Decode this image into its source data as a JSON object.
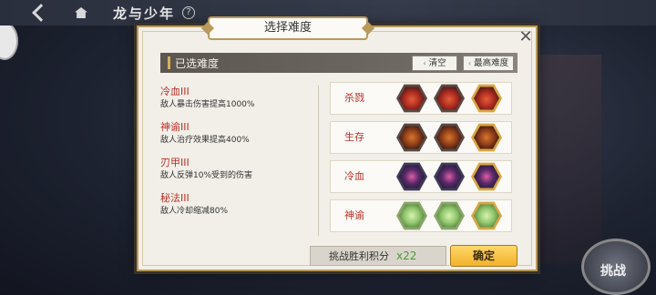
{
  "topbar": {
    "title": "龙与少年",
    "help": "?"
  },
  "dialog": {
    "title": "选择难度",
    "close": "✕",
    "selected_label": "已选难度",
    "clear_label": "清空",
    "max_label": "最高难度"
  },
  "selected": [
    {
      "name": "冷血III",
      "desc": "敌人暴击伤害提高1000%"
    },
    {
      "name": "神谕III",
      "desc": "敌人治疗效果提高400%"
    },
    {
      "name": "刃甲III",
      "desc": "敌人反弹10%受到的伤害"
    },
    {
      "name": "秘法III",
      "desc": "敌人冷却缩减80%"
    }
  ],
  "categories": [
    {
      "name": "杀戮",
      "levels_selected": 0
    },
    {
      "name": "生存",
      "levels_selected": 0
    },
    {
      "name": "冷血",
      "levels_selected": 3
    },
    {
      "name": "神谕",
      "levels_selected": 3
    }
  ],
  "footer": {
    "score_label": "挑战胜利积分",
    "score_value": "x22",
    "confirm_label": "确定"
  },
  "background": {
    "bottom_right_button": "挑战"
  },
  "colors": {
    "accent_gold": "#b89a5c",
    "name_red": "#b8322a",
    "confirm": "#f2b12b",
    "score_green": "#4a9a3a"
  }
}
